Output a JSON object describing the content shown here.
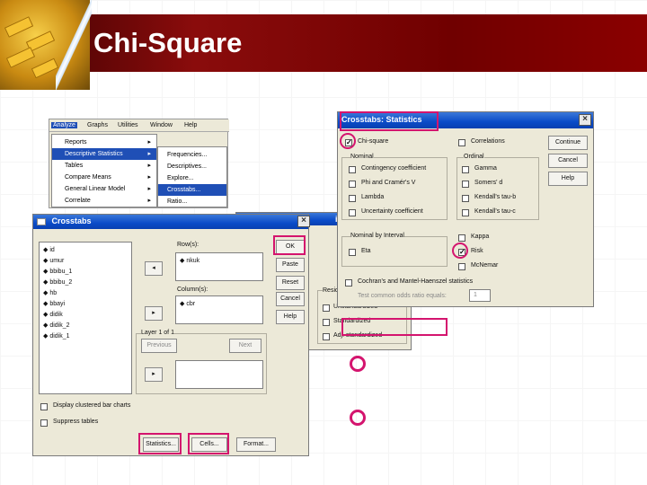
{
  "slide": {
    "title": "Chi-Square"
  },
  "spss_menu": {
    "menubar": [
      "Analyze",
      "Graphs",
      "Utilities",
      "Window",
      "Help"
    ],
    "items": [
      {
        "label": "Reports",
        "has_sub": true
      },
      {
        "label": "Descriptive Statistics",
        "has_sub": true,
        "selected": true
      },
      {
        "label": "Tables",
        "has_sub": true
      },
      {
        "label": "Compare Means",
        "has_sub": true
      },
      {
        "label": "General Linear Model",
        "has_sub": true
      },
      {
        "label": "Correlate",
        "has_sub": true
      }
    ],
    "submenu": [
      {
        "label": "Frequencies..."
      },
      {
        "label": "Descriptives..."
      },
      {
        "label": "Explore..."
      },
      {
        "label": "Crosstabs...",
        "selected": true
      },
      {
        "label": "Ratio..."
      }
    ]
  },
  "crosstabs": {
    "title": "Crosstabs",
    "variables": [
      "id",
      "umur",
      "bbibu_1",
      "bbibu_2",
      "hb",
      "bbayi",
      "didik",
      "didik_2",
      "didik_1"
    ],
    "rows_label": "Row(s):",
    "rows_value": "nkuk",
    "columns_label": "Column(s):",
    "columns_value": "cbr",
    "layer_label": "Layer 1 of 1",
    "previous": "Previous",
    "next": "Next",
    "buttons": {
      "ok": "OK",
      "paste": "Paste",
      "reset": "Reset",
      "cancel": "Cancel",
      "help": "Help"
    },
    "display_clustered": "Display clustered bar charts",
    "suppress_tables": "Suppress tables",
    "bottom_buttons": {
      "statistics": "Statistics...",
      "cells": "Cells...",
      "format": "Format..."
    }
  },
  "cell_display": {
    "title_fragment": "isplay",
    "residuals_label": "Resid",
    "options": [
      "Unstandardized",
      "Standardized",
      "Adj. standardized"
    ]
  },
  "statistics": {
    "title": "Crosstabs: Statistics",
    "chisquare": "Chi-square",
    "correlations": "Correlations",
    "nominal_label": "Nominal",
    "nominal": [
      "Contingency coefficient",
      "Phi and Cramér's V",
      "Lambda",
      "Uncertainty coefficient"
    ],
    "ordinal_label": "Ordinal",
    "ordinal": [
      "Gamma",
      "Somers' d",
      "Kendall's tau-b",
      "Kendall's tau-c"
    ],
    "interval_label": "Nominal by Interval",
    "eta": "Eta",
    "kappa": "Kappa",
    "risk": "Risk",
    "mcnemar": "McNemar",
    "cochran": "Cochran's and Mantel-Haenszel statistics",
    "odds_label": "Test common odds ratio equals:",
    "odds_value": "1",
    "buttons": {
      "continue": "Continue",
      "cancel": "Cancel",
      "help": "Help"
    }
  },
  "colors": {
    "highlight": "#d4146e",
    "banner": "#8a0c0c",
    "titlebar": "#0a4bc8"
  }
}
